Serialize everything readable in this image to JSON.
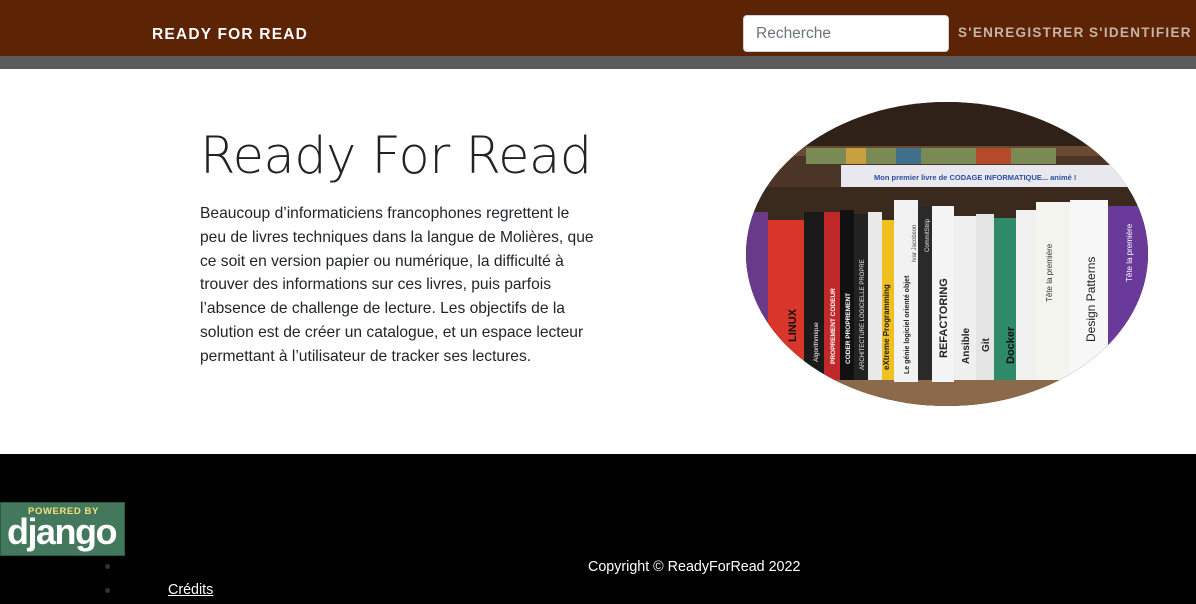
{
  "navbar": {
    "brand": "READY FOR READ",
    "search_placeholder": "Recherche",
    "register_label": "S'ENREGISTRER",
    "login_label": "S'IDENTIFIER",
    "background_color": "#5c2305"
  },
  "hero": {
    "title": "Ready For Read",
    "description": "Beaucoup d’informaticiens francophones regrettent le peu de livres techniques dans la langue de Molières, que ce soit en version papier ou numérique, la difficulté à trouver des informations sur ces livres, puis parfois l’absence de challenge de lecture. Les objectifs de la solution est de créer un catalogue, et un espace lecteur permettant à l’utilisateur de tracker ses lectures.",
    "image": {
      "shelf_label": "Mon premier livre de CODAGE INFORMATIQUE... animé !",
      "spines": [
        "LINUX",
        "Algorithmique",
        "PROPREMENT CODEUR",
        "CODER PROPREMENT",
        "ARCHITECTURE LOGICIELLE PROPRE",
        "eXtreme Programming",
        "Le génie logiciel orienté objet",
        "Ivar Jacobson",
        "REFACTORING",
        "CommitStrip",
        "Ansible",
        "Git",
        "Docker",
        "Tête la première",
        "Design Patterns",
        "Tête la première"
      ]
    }
  },
  "footer": {
    "badge": {
      "powered": "POWERED BY",
      "name": "django"
    },
    "copyright": "Copyright © ReadyForRead 2022",
    "credits_label": "Crédits"
  }
}
